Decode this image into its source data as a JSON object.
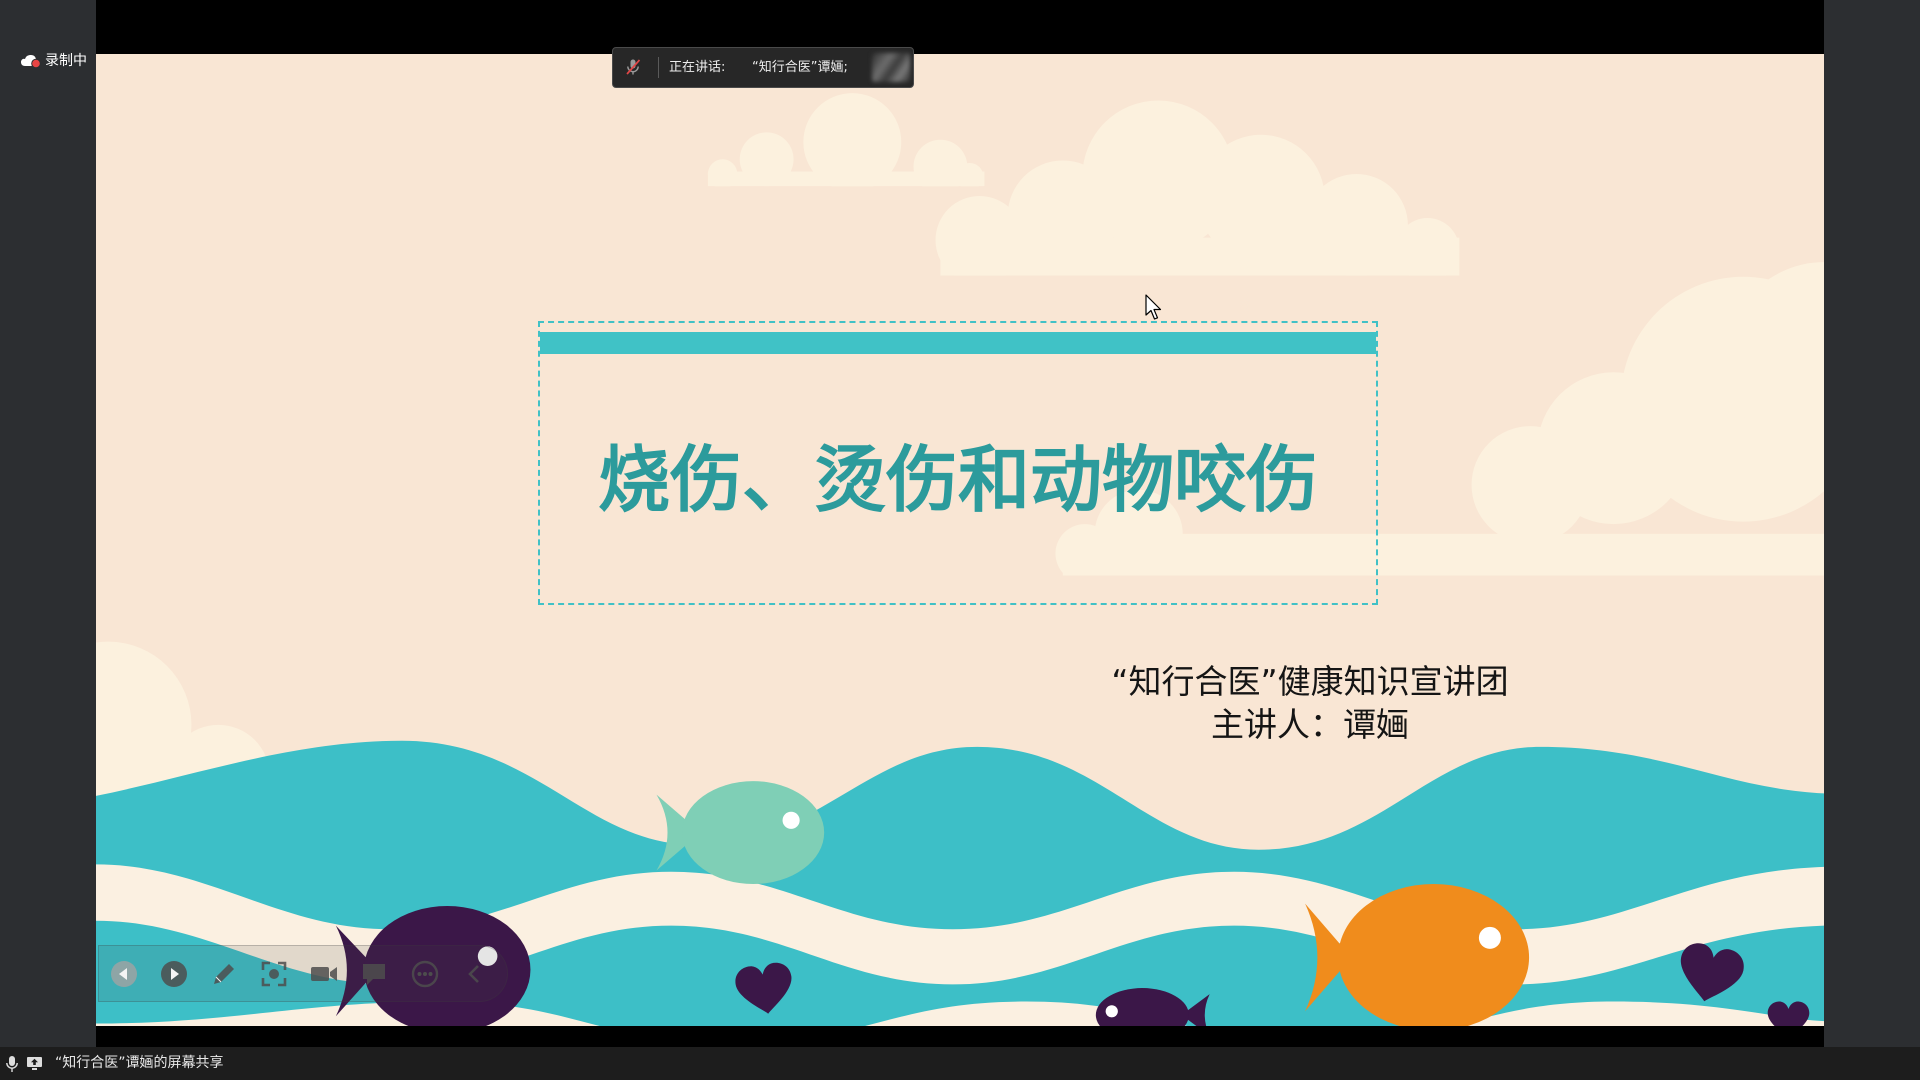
{
  "recording_indicator": {
    "icon": "cloud-recording-icon",
    "label": "录制中"
  },
  "speaking_indicator": {
    "mic_icon": "mic-muted-icon",
    "label": "正在讲话:",
    "speaker": "“知行合医”谭婳;"
  },
  "slide": {
    "title": "烧伤、烫伤和动物咬伤",
    "organization": "“知行合医”健康知识宣讲团",
    "presenter": "主讲人：谭婳"
  },
  "presentation_toolbar": {
    "buttons": [
      {
        "icon": "previous-slide-icon",
        "enabled": false
      },
      {
        "icon": "next-slide-icon",
        "enabled": true
      },
      {
        "icon": "pen-icon",
        "enabled": true
      },
      {
        "icon": "screenshot-icon",
        "enabled": true
      },
      {
        "icon": "camera-icon",
        "enabled": true
      },
      {
        "icon": "comment-icon",
        "enabled": true
      },
      {
        "icon": "more-icon",
        "enabled": true
      },
      {
        "icon": "collapse-chevron-icon",
        "enabled": true
      }
    ]
  },
  "cursor": {
    "icon": "mouse-pointer-icon"
  },
  "status_bar": {
    "mic_icon": "microphone-icon",
    "share_icon": "screen-share-icon",
    "share_label": "“知行合医”谭婳的屏幕共享"
  },
  "colors": {
    "slide_background": "#f9e6d4",
    "cloud": "#fcf1de",
    "wave_teal": "#3dbfc7",
    "wave_cream": "#fbf0e1",
    "title_text": "#2c9b9c",
    "title_bar": "#40c2c6",
    "fish_green": "#7fcfb6",
    "fish_purple": "#3b1748",
    "fish_orange": "#f08c1c",
    "recording_dot": "#e84545"
  }
}
